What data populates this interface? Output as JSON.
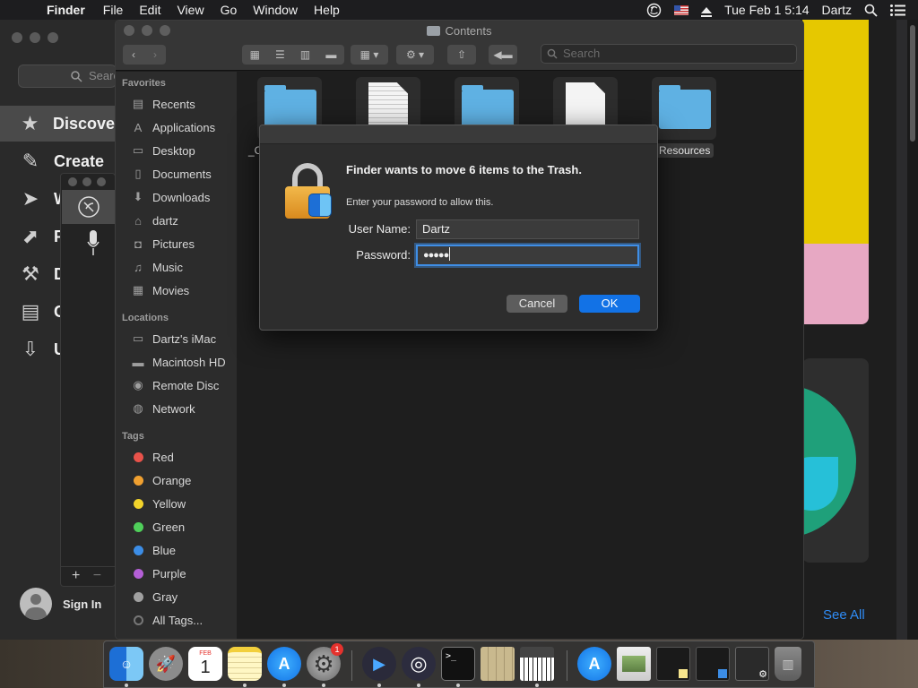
{
  "menubar": {
    "app": "Finder",
    "menus": [
      "File",
      "Edit",
      "View",
      "Go",
      "Window",
      "Help"
    ],
    "datetime": "Tue Feb 1  5:14",
    "user": "Dartz"
  },
  "appstore": {
    "search_placeholder": "Searc",
    "nav": [
      "Discover",
      "Create",
      "W",
      "P",
      "D",
      "C",
      "U"
    ],
    "sign_in": "Sign In",
    "see_all": "See All"
  },
  "finder": {
    "title": "Contents",
    "search_placeholder": "Search",
    "sidebar": {
      "favorites_header": "Favorites",
      "favorites": [
        "Recents",
        "Applications",
        "Desktop",
        "Documents",
        "Downloads",
        "dartz",
        "Pictures",
        "Music",
        "Movies"
      ],
      "locations_header": "Locations",
      "locations": [
        "Dartz's iMac",
        "Macintosh HD",
        "Remote Disc",
        "Network"
      ],
      "tags_header": "Tags",
      "tags": [
        {
          "name": "Red",
          "color": "#e8524a"
        },
        {
          "name": "Orange",
          "color": "#f0a030"
        },
        {
          "name": "Yellow",
          "color": "#f2d32b"
        },
        {
          "name": "Green",
          "color": "#4fcf5a"
        },
        {
          "name": "Blue",
          "color": "#3c8de6"
        },
        {
          "name": "Purple",
          "color": "#b45fd6"
        },
        {
          "name": "Gray",
          "color": "#a0a0a0"
        }
      ],
      "all_tags": "All Tags..."
    },
    "files": {
      "first_label": "_C",
      "resources": "Resources"
    }
  },
  "dialog": {
    "title": "Finder wants to move 6 items to the Trash.",
    "subtitle": "Enter your password to allow this.",
    "username_label": "User Name:",
    "username_value": "Dartz",
    "password_label": "Password:",
    "password_value": "●●●●●",
    "cancel": "Cancel",
    "ok": "OK"
  },
  "dock": {
    "calendar_month": "FEB",
    "calendar_day": "1",
    "sysprefs_badge": "1"
  }
}
